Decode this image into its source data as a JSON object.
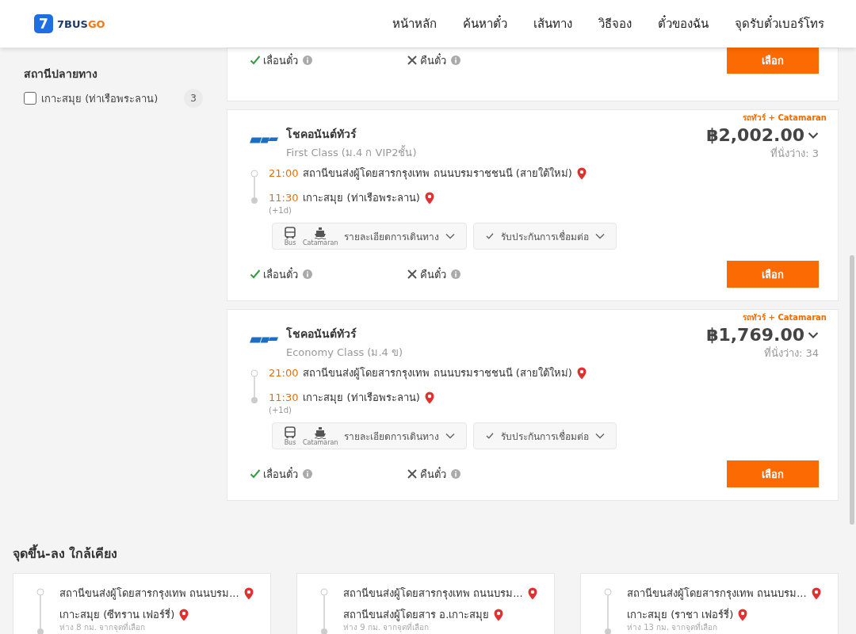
{
  "header": {
    "logo": {
      "mark": "7",
      "name": "7BUS",
      "accent": "GO"
    },
    "nav": [
      {
        "label": "หน้าหลัก"
      },
      {
        "label": "ค้นหาตั๋ว"
      },
      {
        "label": "เส้นทาง"
      },
      {
        "label": "วิธีจอง"
      },
      {
        "label": "ตั๋วของฉัน"
      },
      {
        "label": "จุดรับตั๋วเบอร์โทร"
      }
    ]
  },
  "sidebar": {
    "title": "สถานีปลายทาง",
    "options": [
      {
        "label": "เกาะสมุย (ท่าเรือพระลาน)",
        "count": "3",
        "checked": false
      }
    ]
  },
  "partial_card": {
    "policies": [
      {
        "label": "เลื่อนตั๋ว",
        "allowed": true
      },
      {
        "label": "คืนตั๋ว",
        "allowed": false
      }
    ],
    "select": "เลือก"
  },
  "trips": [
    {
      "tag": "รถทัวร์ + Catamaran",
      "operator": "โชคอนันต์ทัวร์",
      "class": "First Class (ม.4 ก VIP2ชั้น)",
      "price": "฿2,002.00",
      "seats": "ที่นั่งว่าง: 3",
      "depart_time": "21:00",
      "depart": "สถานีขนส่งผู้โดยสารกรุงเทพ ถนนบรมราชชนนี (สายใต้ใหม่)",
      "arrive_time": "11:30",
      "arrive": "เกาะสมุย (ท่าเรือพระลาน)",
      "day_offset": "(+1d)",
      "modes": [
        "Bus",
        "Catamaran"
      ],
      "details": "รายละเอียดการเดินทาง",
      "guarantee": "รับประกันการเชื่อมต่อ",
      "policies": [
        {
          "label": "เลื่อนตั๋ว",
          "allowed": true
        },
        {
          "label": "คืนตั๋ว",
          "allowed": false
        }
      ],
      "select": "เลือก"
    },
    {
      "tag": "รถทัวร์ + Catamaran",
      "operator": "โชคอนันต์ทัวร์",
      "class": "Economy Class (ม.4 ข)",
      "price": "฿1,769.00",
      "seats": "ที่นั่งว่าง: 34",
      "depart_time": "21:00",
      "depart": "สถานีขนส่งผู้โดยสารกรุงเทพ ถนนบรมราชชนนี (สายใต้ใหม่)",
      "arrive_time": "11:30",
      "arrive": "เกาะสมุย (ท่าเรือพระลาน)",
      "day_offset": "(+1d)",
      "modes": [
        "Bus",
        "Catamaran"
      ],
      "details": "รายละเอียดการเดินทาง",
      "guarantee": "รับประกันการเชื่อมต่อ",
      "policies": [
        {
          "label": "เลื่อนตั๋ว",
          "allowed": true
        },
        {
          "label": "คืนตั๋ว",
          "allowed": false
        }
      ],
      "select": "เลือก"
    }
  ],
  "nearby": {
    "title": "จุดขึ้น-ลง ใกล้เคียง",
    "cards": [
      {
        "from": "สถานีขนส่งผู้โดยสารกรุงเทพ ถนนบรม...",
        "to": "เกาะสมุย (ซีทราน เฟอร์รี่)",
        "distance": "ห่าง 8 กม. จากจุดที่เลือก"
      },
      {
        "from": "สถานีขนส่งผู้โดยสารกรุงเทพ ถนนบรม...",
        "to": "สถานีขนส่งผู้โดยสาร อ.เกาะสมุย",
        "distance": "ห่าง 9 กม. จากจุดที่เลือก"
      },
      {
        "from": "สถานีขนส่งผู้โดยสารกรุงเทพ ถนนบรม...",
        "to": "เกาะสมุย (ราชา เฟอร์รี่)",
        "distance": "ห่าง 13 กม. จากจุดที่เลือก"
      }
    ]
  }
}
